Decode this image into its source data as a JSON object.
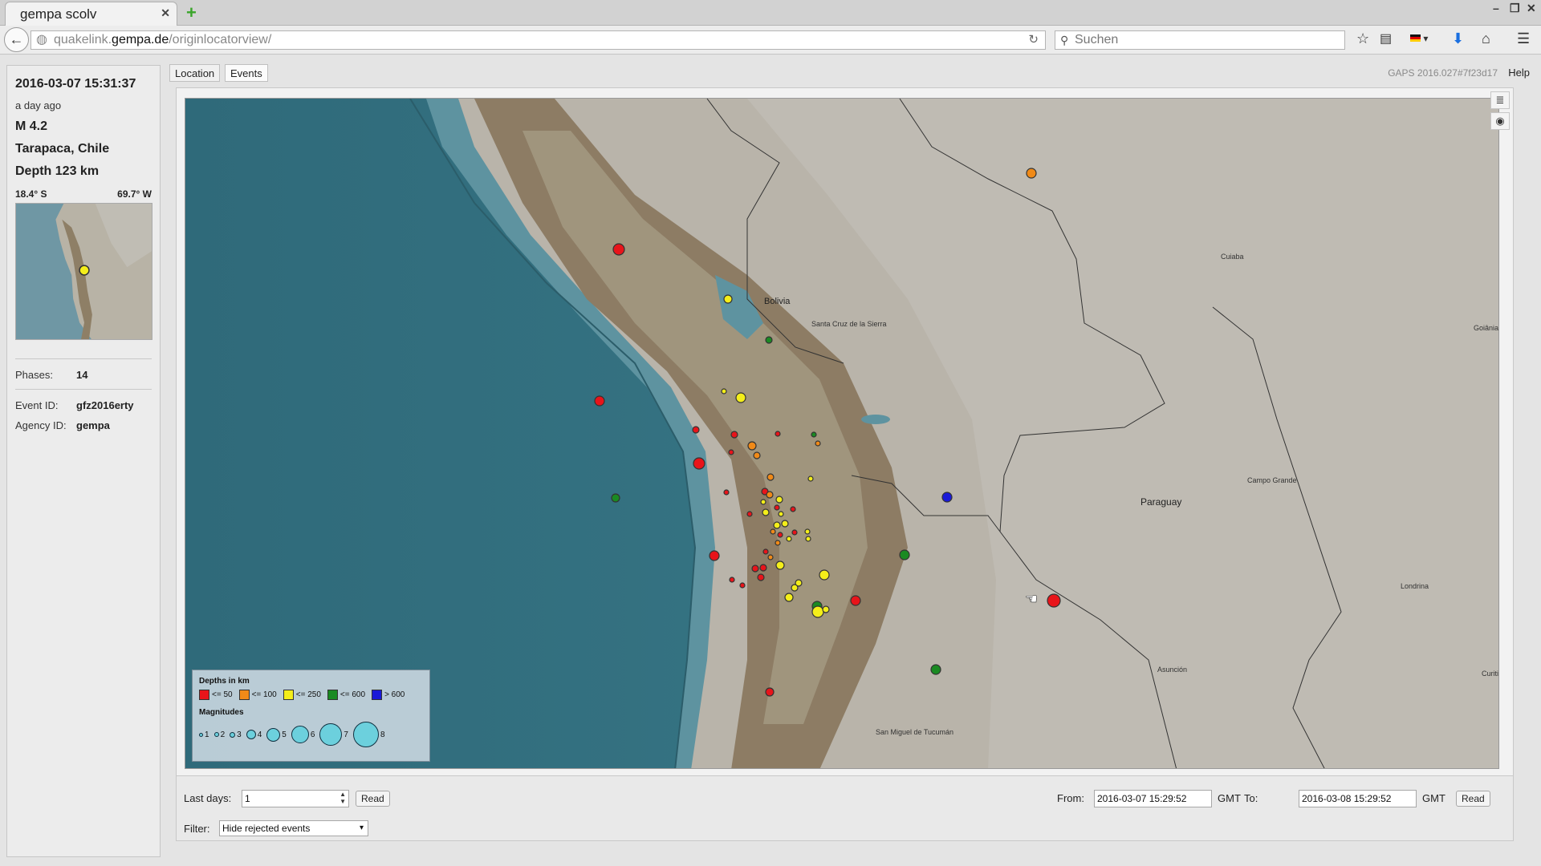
{
  "browser": {
    "tab_title": "gempa scolv",
    "url_prefix": "quakelink.",
    "url_host": "gempa.de",
    "url_path": "/originlocatorview/",
    "search_placeholder": "Suchen"
  },
  "app": {
    "tabs": [
      "Location",
      "Events"
    ],
    "version": "GAPS 2016.027#7f23d17",
    "help": "Help"
  },
  "event": {
    "time": "2016-03-07 15:31:37",
    "ago": "a day ago",
    "magnitude": "M 4.2",
    "region": "Tarapaca, Chile",
    "depth": "Depth 123 km",
    "lat": "18.4° S",
    "lon": "69.7° W",
    "phases_label": "Phases:",
    "phases": "14",
    "event_id_label": "Event ID:",
    "event_id": "gfz2016erty",
    "agency_label": "Agency ID:",
    "agency": "gempa"
  },
  "map": {
    "labels": {
      "bolivia": "Bolivia",
      "santa_cruz": "Santa Cruz de la Sierra",
      "paraguay": "Paraguay",
      "cuiaba": "Cuiaba",
      "goiania": "Goiânia",
      "campo_grande": "Campo Grande",
      "londrina": "Londrina",
      "curitiba": "Curitib",
      "asuncion": "Asunción",
      "tucuman": "San Miguel de Tucumán"
    },
    "legend": {
      "depth_title": "Depths in km",
      "depths": [
        {
          "label": "<= 50",
          "color": "#e8141a"
        },
        {
          "label": "<= 100",
          "color": "#f08a18"
        },
        {
          "label": "<= 250",
          "color": "#f4ee1a"
        },
        {
          "label": "<= 600",
          "color": "#1a8a22"
        },
        {
          "label": "> 600",
          "color": "#1a1ad8"
        }
      ],
      "mag_title": "Magnitudes",
      "mags": [
        "1",
        "2",
        "3",
        "4",
        "5",
        "6",
        "7",
        "8"
      ]
    }
  },
  "controls": {
    "last_days_label": "Last days:",
    "last_days_value": "1",
    "read_label": "Read",
    "from_label": "From:",
    "from_value": "2016-03-07 15:29:52",
    "gmt": "GMT",
    "to_label": "To:",
    "to_value": "2016-03-08 15:29:52",
    "read2_label": "Read",
    "filter_label": "Filter:",
    "filter_value": "Hide rejected events"
  }
}
